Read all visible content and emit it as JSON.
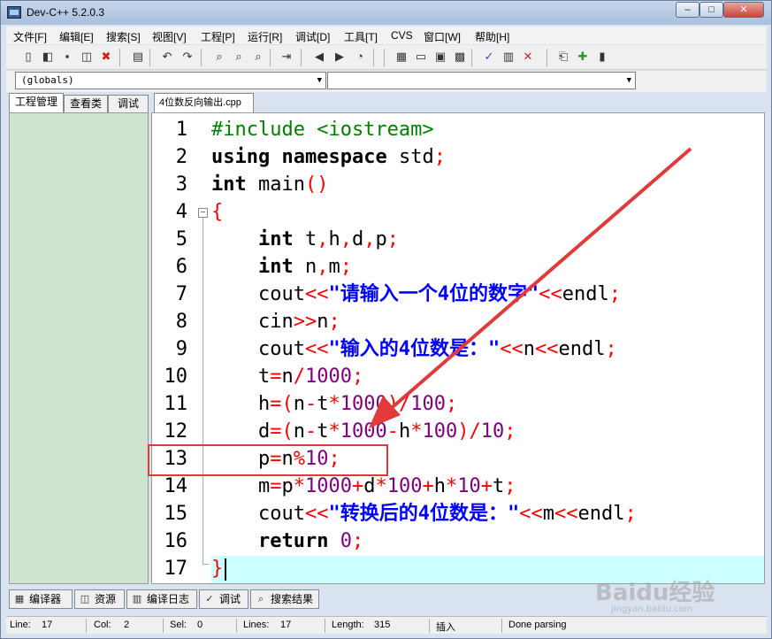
{
  "window": {
    "title": "Dev-C++ 5.2.0.3",
    "controls": {
      "minimize": "–",
      "maximize": "□",
      "close": "✕"
    }
  },
  "menubar": [
    "文件[F]",
    "编辑[E]",
    "搜索[S]",
    "视图[V]",
    "工程[P]",
    "运行[R]",
    "调试[D]",
    "工具[T]",
    "CVS",
    "窗口[W]",
    "帮助[H]"
  ],
  "toolbar": {
    "icons": [
      "new-file-icon",
      "open-icon",
      "save-icon",
      "save-all-icon",
      "close-file-icon",
      "print-icon",
      "undo-icon",
      "redo-icon",
      "find-icon",
      "replace-icon",
      "find-next-icon",
      "goto-line-icon",
      "indent-icon",
      "unindent-icon",
      "toggle-comment-icon",
      "compile-icon",
      "run-icon",
      "compile-run-icon",
      "rebuild-icon",
      "check-icon",
      "chart-icon",
      "stop-icon",
      "new-project-icon",
      "add-to-project-icon",
      "bookmark-icon"
    ]
  },
  "combos": {
    "scope": "(globals)",
    "members": ""
  },
  "left_panel": {
    "tabs": [
      "工程管理",
      "查看类",
      "调试"
    ]
  },
  "editor": {
    "file_tab": "4位数反向输出.cpp",
    "line_numbers": [
      "1",
      "2",
      "3",
      "4",
      "5",
      "6",
      "7",
      "8",
      "9",
      "10",
      "11",
      "12",
      "13",
      "14",
      "15",
      "16",
      "17"
    ],
    "lines": [
      [
        {
          "t": "#include <iostream>",
          "c": "pp"
        }
      ],
      [
        {
          "t": "using",
          "c": "kw"
        },
        {
          "t": " ",
          "c": "id"
        },
        {
          "t": "namespace",
          "c": "kw"
        },
        {
          "t": " std",
          "c": "id"
        },
        {
          "t": ";",
          "c": "op"
        }
      ],
      [
        {
          "t": "int",
          "c": "kw"
        },
        {
          "t": " main",
          "c": "id"
        },
        {
          "t": "()",
          "c": "op"
        }
      ],
      [
        {
          "t": "{",
          "c": "op"
        }
      ],
      [
        {
          "t": "    ",
          "c": "id"
        },
        {
          "t": "int",
          "c": "kw"
        },
        {
          "t": " t",
          "c": "id"
        },
        {
          "t": ",",
          "c": "op"
        },
        {
          "t": "h",
          "c": "id"
        },
        {
          "t": ",",
          "c": "op"
        },
        {
          "t": "d",
          "c": "id"
        },
        {
          "t": ",",
          "c": "op"
        },
        {
          "t": "p",
          "c": "id"
        },
        {
          "t": ";",
          "c": "op"
        }
      ],
      [
        {
          "t": "    ",
          "c": "id"
        },
        {
          "t": "int",
          "c": "kw"
        },
        {
          "t": " n",
          "c": "id"
        },
        {
          "t": ",",
          "c": "op"
        },
        {
          "t": "m",
          "c": "id"
        },
        {
          "t": ";",
          "c": "op"
        }
      ],
      [
        {
          "t": "    cout",
          "c": "id"
        },
        {
          "t": "<<",
          "c": "op"
        },
        {
          "t": "\"请输入一个4位的数字\"",
          "c": "str"
        },
        {
          "t": "<<",
          "c": "op"
        },
        {
          "t": "endl",
          "c": "id"
        },
        {
          "t": ";",
          "c": "op"
        }
      ],
      [
        {
          "t": "    cin",
          "c": "id"
        },
        {
          "t": ">>",
          "c": "op"
        },
        {
          "t": "n",
          "c": "id"
        },
        {
          "t": ";",
          "c": "op"
        }
      ],
      [
        {
          "t": "    cout",
          "c": "id"
        },
        {
          "t": "<<",
          "c": "op"
        },
        {
          "t": "\"输入的4位数是：\"",
          "c": "str"
        },
        {
          "t": "<<",
          "c": "op"
        },
        {
          "t": "n",
          "c": "id"
        },
        {
          "t": "<<",
          "c": "op"
        },
        {
          "t": "endl",
          "c": "id"
        },
        {
          "t": ";",
          "c": "op"
        }
      ],
      [
        {
          "t": "    t",
          "c": "id"
        },
        {
          "t": "=",
          "c": "op"
        },
        {
          "t": "n",
          "c": "id"
        },
        {
          "t": "/",
          "c": "op"
        },
        {
          "t": "1000",
          "c": "num"
        },
        {
          "t": ";",
          "c": "op"
        }
      ],
      [
        {
          "t": "    h",
          "c": "id"
        },
        {
          "t": "=(",
          "c": "op"
        },
        {
          "t": "n",
          "c": "id"
        },
        {
          "t": "-",
          "c": "op"
        },
        {
          "t": "t",
          "c": "id"
        },
        {
          "t": "*",
          "c": "op"
        },
        {
          "t": "1000",
          "c": "num"
        },
        {
          "t": ")/",
          "c": "op"
        },
        {
          "t": "100",
          "c": "num"
        },
        {
          "t": ";",
          "c": "op"
        }
      ],
      [
        {
          "t": "    d",
          "c": "id"
        },
        {
          "t": "=(",
          "c": "op"
        },
        {
          "t": "n",
          "c": "id"
        },
        {
          "t": "-",
          "c": "op"
        },
        {
          "t": "t",
          "c": "id"
        },
        {
          "t": "*",
          "c": "op"
        },
        {
          "t": "1000",
          "c": "num"
        },
        {
          "t": "-",
          "c": "op"
        },
        {
          "t": "h",
          "c": "id"
        },
        {
          "t": "*",
          "c": "op"
        },
        {
          "t": "100",
          "c": "num"
        },
        {
          "t": ")/",
          "c": "op"
        },
        {
          "t": "10",
          "c": "num"
        },
        {
          "t": ";",
          "c": "op"
        }
      ],
      [
        {
          "t": "    p",
          "c": "id"
        },
        {
          "t": "=",
          "c": "op"
        },
        {
          "t": "n",
          "c": "id"
        },
        {
          "t": "%",
          "c": "op"
        },
        {
          "t": "10",
          "c": "num"
        },
        {
          "t": ";",
          "c": "op"
        }
      ],
      [
        {
          "t": "    m",
          "c": "id"
        },
        {
          "t": "=",
          "c": "op"
        },
        {
          "t": "p",
          "c": "id"
        },
        {
          "t": "*",
          "c": "op"
        },
        {
          "t": "1000",
          "c": "num"
        },
        {
          "t": "+",
          "c": "op"
        },
        {
          "t": "d",
          "c": "id"
        },
        {
          "t": "*",
          "c": "op"
        },
        {
          "t": "100",
          "c": "num"
        },
        {
          "t": "+",
          "c": "op"
        },
        {
          "t": "h",
          "c": "id"
        },
        {
          "t": "*",
          "c": "op"
        },
        {
          "t": "10",
          "c": "num"
        },
        {
          "t": "+",
          "c": "op"
        },
        {
          "t": "t",
          "c": "id"
        },
        {
          "t": ";",
          "c": "op"
        }
      ],
      [
        {
          "t": "    cout",
          "c": "id"
        },
        {
          "t": "<<",
          "c": "op"
        },
        {
          "t": "\"转换后的4位数是：\"",
          "c": "str"
        },
        {
          "t": "<<",
          "c": "op"
        },
        {
          "t": "m",
          "c": "id"
        },
        {
          "t": "<<",
          "c": "op"
        },
        {
          "t": "endl",
          "c": "id"
        },
        {
          "t": ";",
          "c": "op"
        }
      ],
      [
        {
          "t": "    ",
          "c": "id"
        },
        {
          "t": "return",
          "c": "kw"
        },
        {
          "t": " ",
          "c": "id"
        },
        {
          "t": "0",
          "c": "num"
        },
        {
          "t": ";",
          "c": "op"
        }
      ],
      [
        {
          "t": "}",
          "c": "op"
        }
      ]
    ],
    "highlighted_line": 13,
    "current_line": 17
  },
  "bottom_tabs": [
    {
      "label": "编译器",
      "icon": "compiler-grid-icon"
    },
    {
      "label": "资源",
      "icon": "resources-icon"
    },
    {
      "label": "编译日志",
      "icon": "chart-icon"
    },
    {
      "label": "调试",
      "icon": "check-icon"
    },
    {
      "label": "搜索结果",
      "icon": "search-icon"
    }
  ],
  "statusbar": {
    "line_label": "Line:",
    "line": "17",
    "col_label": "Col:",
    "col": "2",
    "sel_label": "Sel:",
    "sel": "0",
    "lines_label": "Lines:",
    "lines": "17",
    "length_label": "Length:",
    "length": "315",
    "mode": "插入",
    "status": "Done parsing"
  },
  "watermark": {
    "text": "Baidu经验",
    "sub": "jingyan.baidu.com"
  }
}
